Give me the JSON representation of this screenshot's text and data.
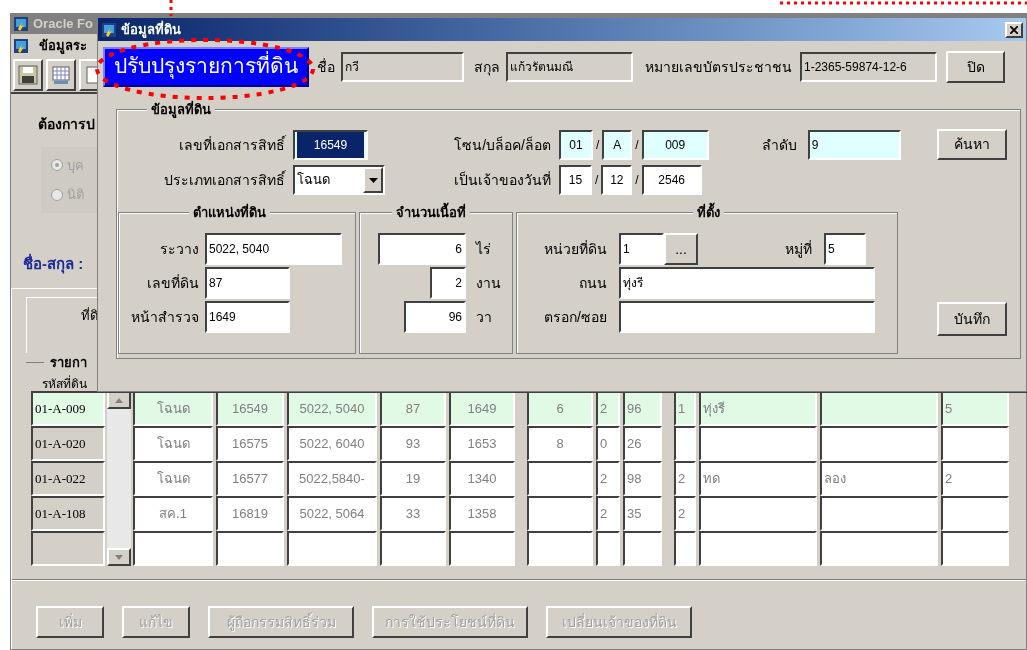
{
  "background_window": {
    "title": "Oracle Fo",
    "menu": "ข้อมูลระ",
    "question": "ต้องการป",
    "radios": [
      {
        "label": "บุค",
        "selected": true,
        "disabled": true
      },
      {
        "label": "นิติ",
        "selected": false,
        "disabled": true
      }
    ],
    "name_label": "ชื่อ-สกุล :",
    "tab": {
      "label": "ที่ดิ",
      "selected": true
    },
    "group_label": "รายกา",
    "table": {
      "columns": [
        "รหัสที่ดิน"
      ],
      "rows": [
        {
          "selected": true,
          "cells": [
            "01-A-009",
            "โฉนด",
            "16549",
            "5022, 5040",
            "87",
            "1649",
            "6",
            "2",
            "96",
            "1",
            "ทุ่งรี",
            null,
            "5"
          ]
        },
        {
          "selected": false,
          "cells": [
            "01-A-020",
            "โฉนด",
            "16575",
            "5022, 6040",
            "93",
            "1653",
            "8",
            "0",
            "26",
            null,
            null,
            null,
            null
          ]
        },
        {
          "selected": false,
          "cells": [
            "01-A-022",
            "โฉนด",
            "16577",
            "5022,5840-",
            "19",
            "1340",
            null,
            "2",
            "98",
            "2",
            "ทด",
            "ลอง",
            "2"
          ]
        },
        {
          "selected": false,
          "cells": [
            "01-A-108",
            "สค.1",
            "16819",
            "5022, 5064",
            "33",
            "1358",
            null,
            "2",
            "35",
            "2",
            null,
            null,
            null
          ]
        }
      ]
    },
    "buttons": [
      {
        "label": "เพิ่ม",
        "disabled": true
      },
      {
        "label": "แก้ไข",
        "disabled": true
      },
      {
        "label": "ผู้ถือกรรมสิทธิ์ร่วม",
        "disabled": true
      },
      {
        "label": "การใช้ประโยชน์ที่ดิน",
        "disabled": true
      },
      {
        "label": "เปลี่ยนเจ้าของที่ดิน",
        "disabled": true
      }
    ]
  },
  "dialog": {
    "title": "ข้อมูลที่ดิน",
    "banner": "ปรับปรุงรายการที่ดิน",
    "first_name": {
      "label": "ชื่อ",
      "value": "กวี"
    },
    "last_name": {
      "label": "สกุล",
      "value": "แก้วรัตนมณี"
    },
    "id_card": {
      "label": "หมายเลขบัตรประชาชน",
      "value": "1-2365-59874-12-6"
    },
    "close_button": "ปิด",
    "land_group": {
      "title": "ข้อมูลที่ดิน",
      "doc_no": {
        "label": "เลขที่เอกสารสิทธิ์",
        "value": "16549",
        "required": true,
        "highlighted": true
      },
      "zone": {
        "label": "โซน/บล็อค/ล็อต",
        "parts": [
          "01",
          "A",
          "009"
        ],
        "separators": [
          "/",
          "/"
        ],
        "required": true
      },
      "order": {
        "label": "ลำดับ",
        "value": "9",
        "required": true
      },
      "doc_type": {
        "label": "ประเภทเอกสารสิทธิ์",
        "value": "โฉนด"
      },
      "owner_date": {
        "label": "เป็นเจ้าของวันที่",
        "parts": [
          "15",
          "12",
          "2546"
        ],
        "separators": [
          "/",
          "/"
        ]
      },
      "search_button": "ค้นหา",
      "save_button": "บันทึก",
      "position": {
        "title": "ตำแหน่งที่ดิน",
        "fields": [
          {
            "label": "ระวาง",
            "value": "5022, 5040"
          },
          {
            "label": "เลขที่ดิน",
            "value": "87"
          },
          {
            "label": "หน้าสำรวจ",
            "value": "1649"
          }
        ]
      },
      "area": {
        "title": "จำนวนเนื้อที่",
        "fields": [
          {
            "unit": "ไร่",
            "value": "6"
          },
          {
            "unit": "งาน",
            "value": "2"
          },
          {
            "unit": "วา",
            "value": "96"
          }
        ]
      },
      "location": {
        "title": "ที่ตั้ง",
        "unit": {
          "label": "หน่วยที่ดิน",
          "value": "1",
          "button": "..."
        },
        "village": {
          "label": "หมู่ที่",
          "value": "5"
        },
        "road": {
          "label": "ถนน",
          "value": "ทุ่งรี"
        },
        "alley": {
          "label": "ตรอก/ซอย"
        }
      }
    }
  }
}
